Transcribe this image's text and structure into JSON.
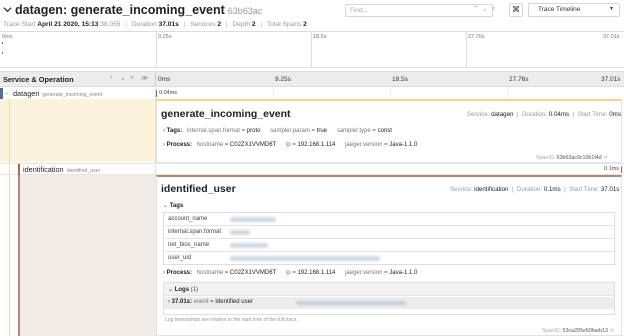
{
  "header": {
    "service": "datagen",
    "operation": "generate_incoming_event",
    "trace_id": "63b63ac",
    "find_placeholder": "Find...",
    "keyboard_label": "⌘",
    "view_label": "Trace Timeline",
    "meta": {
      "trace_start_label": "Trace Start",
      "trace_start_value": "April 21 2020, 15:13",
      "trace_start_ms": ":38.055",
      "duration_label": "Duration",
      "duration_value": "37.01s",
      "services_label": "Services",
      "services_value": "2",
      "depth_label": "Depth",
      "depth_value": "2",
      "spans_label": "Total Spans",
      "spans_value": "2"
    }
  },
  "minimap": {
    "ticks": [
      "0ms",
      "9.25s",
      "18.5s",
      "27.76s",
      "37.01s"
    ]
  },
  "timeline": {
    "header_label": "Service & Operation",
    "ticks": [
      "0ms",
      "9.25s",
      "18.5s",
      "27.76s",
      "37.01s"
    ],
    "rows": [
      {
        "service": "datagen",
        "operation": "generate_incoming_event",
        "duration": "0.04ms"
      },
      {
        "service": "identification",
        "operation": "identified_user",
        "duration": "0.1ms"
      }
    ]
  },
  "span1": {
    "title": "generate_incoming_event",
    "service_label": "Service:",
    "service": "datagen",
    "duration_label": "Duration:",
    "duration": "0.04ms",
    "start_label": "Start Time:",
    "start": "0ms",
    "tags_label": "Tags:",
    "tags": [
      {
        "k": "internal.span.format",
        "v": "proto"
      },
      {
        "k": "sampler.param",
        "v": "true"
      },
      {
        "k": "sampler.type",
        "v": "const"
      }
    ],
    "process_label": "Process:",
    "process": [
      {
        "k": "hostname",
        "v": "C02ZX1VVMD6T"
      },
      {
        "k": "ip",
        "v": "192.168.1.114"
      },
      {
        "k": "jaeger.version",
        "v": "Java-1.1.0"
      }
    ],
    "span_id_label": "SpanID:",
    "span_id": "63b63ac0c10b1f4d"
  },
  "span2": {
    "title": "identified_user",
    "service_label": "Service:",
    "service": "identification",
    "duration_label": "Duration:",
    "duration": "0.1ms",
    "start_label": "Start Time:",
    "start": "37.01s",
    "tags_label": "Tags",
    "tag_rows": [
      "account_name",
      "internal.span.format",
      "net_bios_name",
      "user_uid"
    ],
    "process_label": "Process:",
    "process": [
      {
        "k": "hostname",
        "v": "C02ZX1VVMD6T"
      },
      {
        "k": "ip",
        "v": "192.168.1.114"
      },
      {
        "k": "jaeger.version",
        "v": "Java-1.1.0"
      }
    ],
    "logs_label": "Logs",
    "logs_count": "(1)",
    "log_time": "37.01s:",
    "log_event_key": "event",
    "log_event_value": "Identified user",
    "logs_note": "Log timestamps are relative to the start time of the full trace.",
    "span_id_label": "SpanID:",
    "span_id": "53ca205e50faeb13"
  },
  "colors": {
    "datagen": "#4e6ca6",
    "identification": "#a06b54",
    "datagen_tint": "#fbf3dc",
    "ident_tint": "#f3ebe6"
  }
}
